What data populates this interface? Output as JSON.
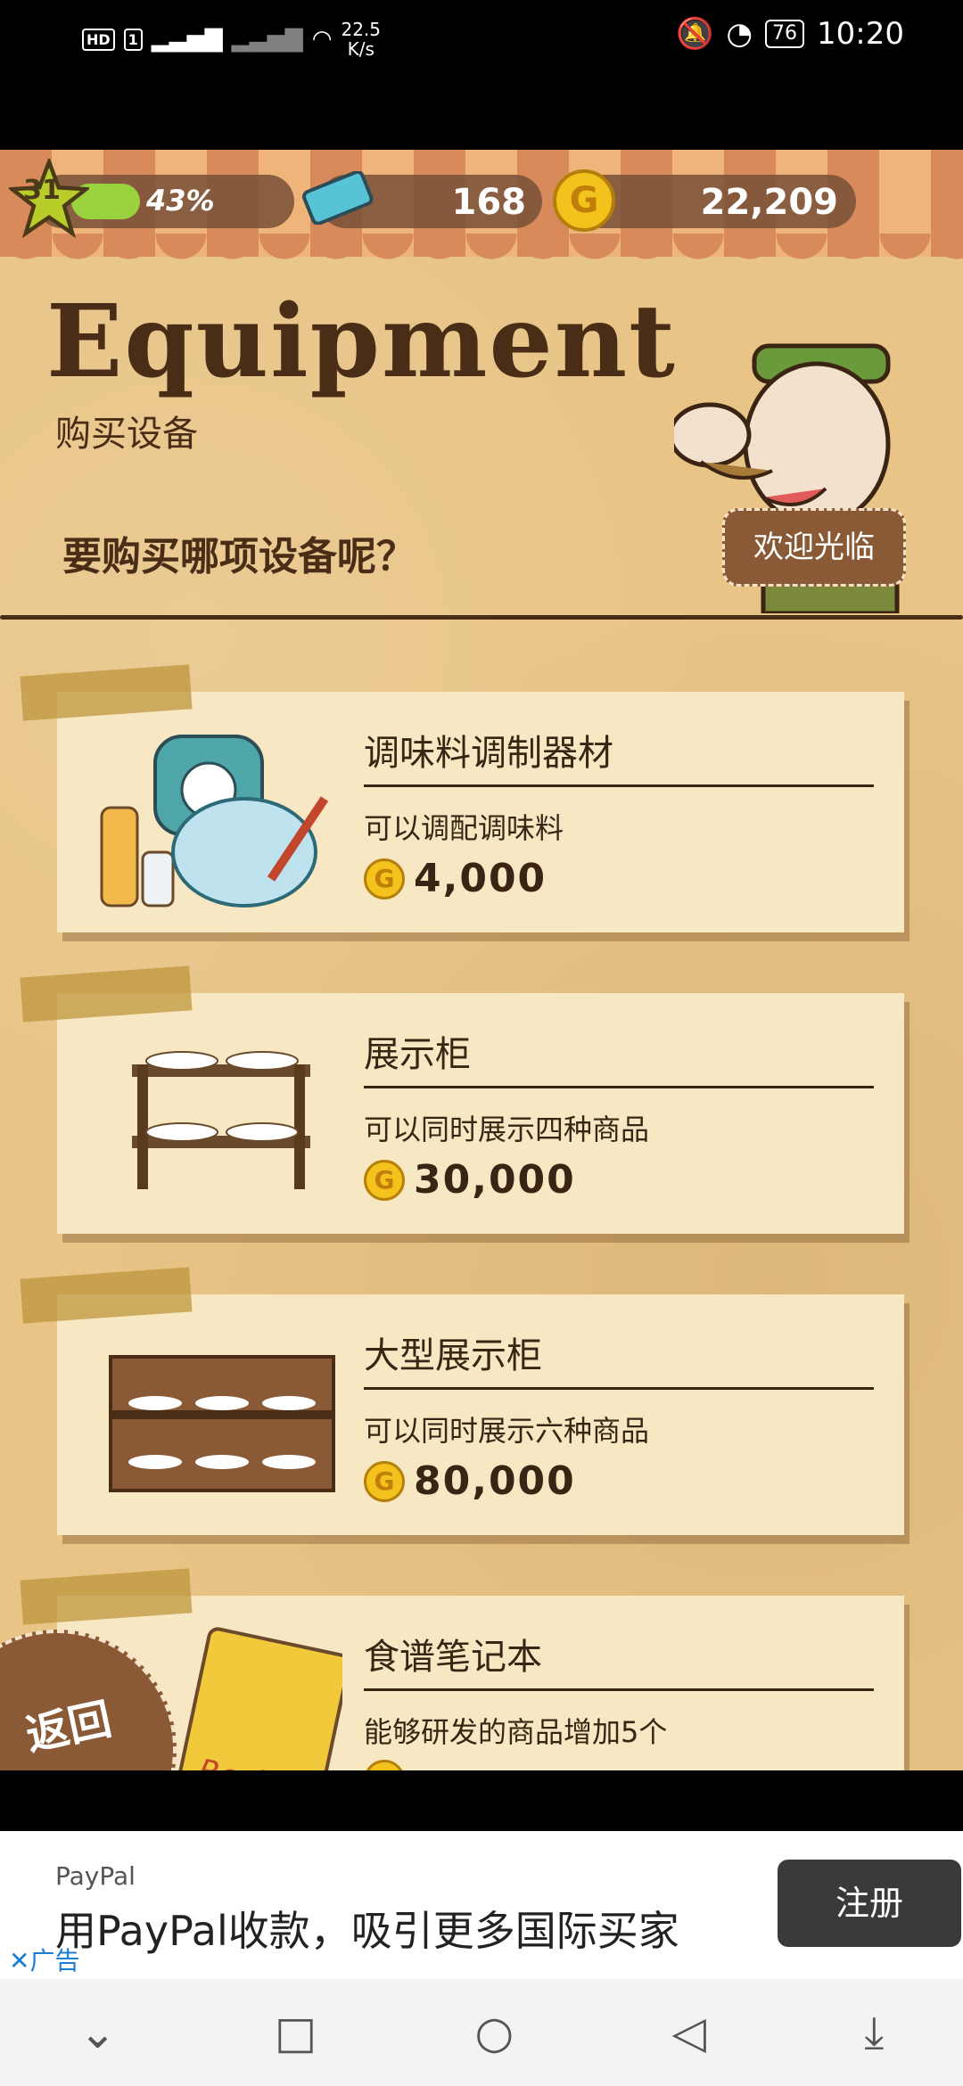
{
  "status_bar": {
    "hd": "HD",
    "sim": "1",
    "net_speed": "22.5",
    "net_unit": "K/s",
    "battery": "76",
    "time": "10:20"
  },
  "hud": {
    "level": "31",
    "xp_percent_text": "43%",
    "xp_fraction": 0.43,
    "tickets": "168",
    "gold": "22,209"
  },
  "header": {
    "title": "Equipment",
    "subtitle": "购买设备",
    "question": "要购买哪项设备呢？",
    "welcome": "欢迎光临"
  },
  "items": [
    {
      "name": "调味料调制器材",
      "desc": "可以调配调味料",
      "price": "4,000",
      "icon": "scale-bowl-icon"
    },
    {
      "name": "展示柜",
      "desc": "可以同时展示四种商品",
      "price": "30,000",
      "icon": "display-shelf-icon"
    },
    {
      "name": "大型展示柜",
      "desc": "可以同时展示六种商品",
      "price": "80,000",
      "icon": "large-display-shelf-icon"
    },
    {
      "name": "食谱笔记本",
      "desc": "能够研发的商品增加5个",
      "price": "",
      "icon": "recipe-notebook-icon"
    }
  ],
  "recipe_book_text": "Recipe",
  "back_button": "返回",
  "ad": {
    "brand": "PayPal",
    "text": "用PayPal收款，吸引更多国际买家",
    "cta": "注册",
    "label": "广告"
  },
  "colors": {
    "background": "#e8c486",
    "card": "#f8e7c3",
    "text_brown": "#4a2d17",
    "coin": "#f3c21c",
    "xp_bar": "#9ad23f"
  }
}
